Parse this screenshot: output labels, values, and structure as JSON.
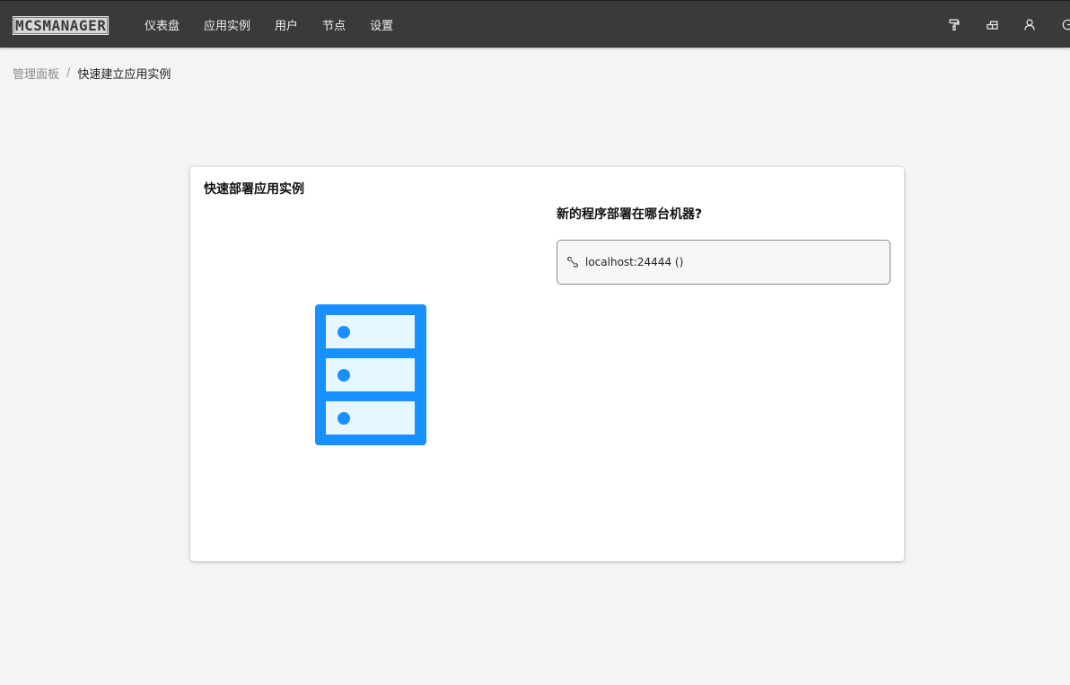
{
  "header": {
    "logo_text": "MCSMANAGER",
    "nav": [
      {
        "label": "仪表盘"
      },
      {
        "label": "应用实例"
      },
      {
        "label": "用户"
      },
      {
        "label": "节点"
      },
      {
        "label": "设置"
      }
    ],
    "right_icons": [
      "paint-roller-icon",
      "layout-icon",
      "user-icon",
      "logout-icon"
    ]
  },
  "breadcrumb": {
    "parent": "管理面板",
    "separator": "/",
    "current": "快速建立应用实例"
  },
  "card": {
    "title": "快速部署应用实例",
    "question": "新的程序部署在哪台机器?",
    "node_option": {
      "icon": "link-icon",
      "label": "localhost:24444 ()"
    },
    "illustration": "server-icon"
  },
  "colors": {
    "topbar": "#3a3a3a",
    "background": "#f4f4f4",
    "accent": "#1890ff",
    "accent_light": "#e6f7ff"
  }
}
